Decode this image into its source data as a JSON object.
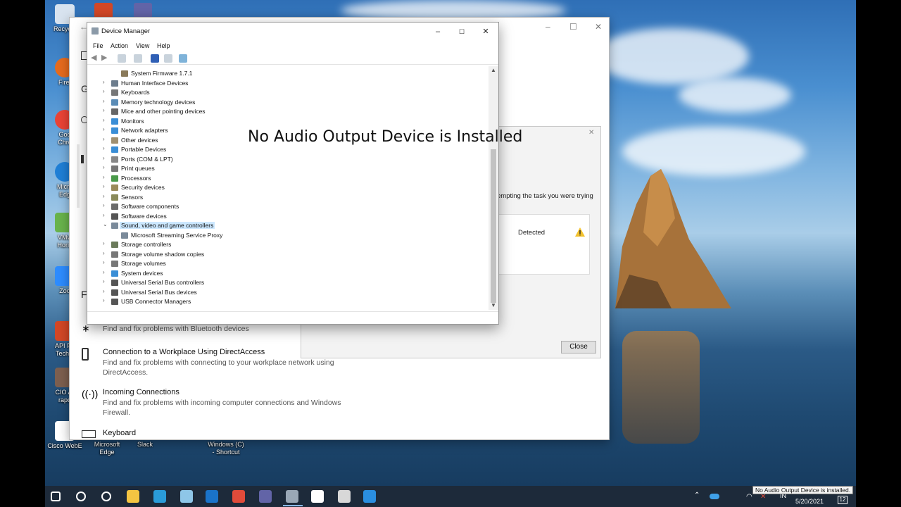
{
  "desktop": {
    "icons": [
      {
        "label": "Recycle",
        "color": "#d8e3ef"
      },
      {
        "label": "Firef",
        "color": "#e66b1d"
      },
      {
        "label": "Goo\nChro",
        "color": "#ea4335"
      },
      {
        "label": "Micro\nEdg",
        "color": "#1f7fd6"
      },
      {
        "label": "VMw\nHoriz",
        "color": "#69b34c"
      },
      {
        "label": "Zoo",
        "color": "#2d8cff"
      },
      {
        "label": "API Pa\nTechni",
        "color": "#d24726"
      },
      {
        "label": "CIO Ar\nrapo",
        "color": "#7d5f4f"
      },
      {
        "label": "Cisco WebE",
        "color": "#ffffff"
      }
    ],
    "bottom_icons": [
      {
        "label": "Microsoft\nEdge"
      },
      {
        "label": "Slack"
      },
      {
        "label": "Windows (C)\n- Shortcut"
      }
    ]
  },
  "settings_window": {
    "items": [
      {
        "title": "",
        "desc": "Find and fix problems with Bluetooth devices"
      },
      {
        "title": "Connection to a Workplace Using DirectAccess",
        "desc": "Find and fix problems with connecting to your workplace network using DirectAccess."
      },
      {
        "title": "Incoming Connections",
        "desc": "Find and fix problems with incoming computer connections and Windows Firewall."
      },
      {
        "title": "Keyboard",
        "desc": ""
      }
    ],
    "left_letters": [
      "G",
      "F"
    ]
  },
  "troubleshooter": {
    "partial_text": "empting the task you were trying",
    "status": "Detected",
    "close_label": "Close"
  },
  "device_manager": {
    "title": "Device Manager",
    "menu": [
      "File",
      "Action",
      "View",
      "Help"
    ],
    "tree": [
      {
        "label": "System Firmware 1.7.1",
        "indent": 1,
        "chev": "",
        "color": "#8a7a5a"
      },
      {
        "label": "Human Interface Devices",
        "indent": 0,
        "chev": "›",
        "color": "#6d7d8d"
      },
      {
        "label": "Keyboards",
        "indent": 0,
        "chev": "›",
        "color": "#777777"
      },
      {
        "label": "Memory technology devices",
        "indent": 0,
        "chev": "›",
        "color": "#5b8cb6"
      },
      {
        "label": "Mice and other pointing devices",
        "indent": 0,
        "chev": "›",
        "color": "#666666"
      },
      {
        "label": "Monitors",
        "indent": 0,
        "chev": "›",
        "color": "#3a8ed6"
      },
      {
        "label": "Network adapters",
        "indent": 0,
        "chev": "›",
        "color": "#3a8ed6"
      },
      {
        "label": "Other devices",
        "indent": 0,
        "chev": "›",
        "color": "#a09070"
      },
      {
        "label": "Portable Devices",
        "indent": 0,
        "chev": "›",
        "color": "#3a8ed6"
      },
      {
        "label": "Ports (COM & LPT)",
        "indent": 0,
        "chev": "›",
        "color": "#888888"
      },
      {
        "label": "Print queues",
        "indent": 0,
        "chev": "›",
        "color": "#777777"
      },
      {
        "label": "Processors",
        "indent": 0,
        "chev": "›",
        "color": "#4a9a4a"
      },
      {
        "label": "Security devices",
        "indent": 0,
        "chev": "›",
        "color": "#9a8a5a"
      },
      {
        "label": "Sensors",
        "indent": 0,
        "chev": "›",
        "color": "#8a8a5a"
      },
      {
        "label": "Software components",
        "indent": 0,
        "chev": "›",
        "color": "#6a6a6a"
      },
      {
        "label": "Software devices",
        "indent": 0,
        "chev": "›",
        "color": "#555555"
      },
      {
        "label": "Sound, video and game controllers",
        "indent": 0,
        "chev": "⌄",
        "color": "#7a8a9a",
        "selected": true
      },
      {
        "label": "Microsoft Streaming Service Proxy",
        "indent": 1,
        "chev": "",
        "color": "#7a8a9a"
      },
      {
        "label": "Storage controllers",
        "indent": 0,
        "chev": "›",
        "color": "#6a7a5a"
      },
      {
        "label": "Storage volume shadow copies",
        "indent": 0,
        "chev": "›",
        "color": "#777777"
      },
      {
        "label": "Storage volumes",
        "indent": 0,
        "chev": "›",
        "color": "#777777"
      },
      {
        "label": "System devices",
        "indent": 0,
        "chev": "›",
        "color": "#3a8ed6"
      },
      {
        "label": "Universal Serial Bus controllers",
        "indent": 0,
        "chev": "›",
        "color": "#555555"
      },
      {
        "label": "Universal Serial Bus devices",
        "indent": 0,
        "chev": "›",
        "color": "#555555"
      },
      {
        "label": "USB Connector Managers",
        "indent": 0,
        "chev": "›",
        "color": "#555555"
      }
    ]
  },
  "overlay_caption": "No Audio Output Device is Installed",
  "taskbar": {
    "apps": [
      {
        "name": "start-icon",
        "color": "#ffffff"
      },
      {
        "name": "search-icon",
        "color": "#ffffff"
      },
      {
        "name": "task-view-icon",
        "color": "#ffffff"
      },
      {
        "name": "file-explorer-icon",
        "color": "#f4c542"
      },
      {
        "name": "edge-icon",
        "color": "#2a9bd8"
      },
      {
        "name": "sticky-notes-icon",
        "color": "#8ec6e8"
      },
      {
        "name": "outlook-icon",
        "color": "#1a73c9"
      },
      {
        "name": "chrome-icon",
        "color": "#e04b3a"
      },
      {
        "name": "teams-icon",
        "color": "#6264a7"
      },
      {
        "name": "device-manager-icon",
        "color": "#9aa8b6"
      },
      {
        "name": "settings-icon",
        "color": "#ffffff"
      },
      {
        "name": "notepad-icon",
        "color": "#d8d8d8"
      },
      {
        "name": "remote-desktop-icon",
        "color": "#2a8ee0"
      }
    ],
    "language": "IN",
    "date": "5/20/2021",
    "notification_count": "12"
  },
  "tooltip": "No Audio Output Device is installed."
}
